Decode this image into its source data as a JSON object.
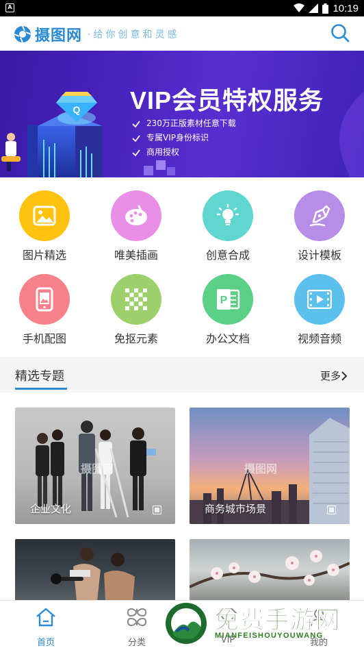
{
  "status_bar": {
    "time": "10:19",
    "notif_letter": "A"
  },
  "header": {
    "logo_text": "摄图网",
    "slogan": "·给你创意和灵感"
  },
  "banner": {
    "title": "VIP会员特权服务",
    "features": [
      "230万正版素材任意下载",
      "专属VIP身份标识",
      "商用授权"
    ],
    "gem_letter": "Q"
  },
  "categories": [
    {
      "label": "图片精选",
      "icon": "image-icon",
      "color": "#ffc20e"
    },
    {
      "label": "唯美插画",
      "icon": "palette-icon",
      "color": "#e98ee6"
    },
    {
      "label": "创意合成",
      "icon": "lightbulb-icon",
      "color": "#5fd6cf"
    },
    {
      "label": "设计模板",
      "icon": "pen-icon",
      "color": "#b88de8"
    },
    {
      "label": "手机配图",
      "icon": "phone-icon",
      "color": "#f6818a"
    },
    {
      "label": "免抠元素",
      "icon": "checker-icon",
      "color": "#9dd06a"
    },
    {
      "label": "办公文档",
      "icon": "ppt-icon",
      "color": "#5ccf86"
    },
    {
      "label": "视频音频",
      "icon": "film-icon",
      "color": "#5cc0ef"
    }
  ],
  "section": {
    "title": "精选专题",
    "more": "更多"
  },
  "topics": [
    {
      "label": "企业文化",
      "watermark": "摄图网"
    },
    {
      "label": "商务城市场景",
      "watermark": "摄图网"
    },
    {
      "label": "",
      "watermark": ""
    },
    {
      "label": "",
      "watermark": ""
    }
  ],
  "bottom_nav": [
    {
      "label": "首页",
      "icon": "home-icon",
      "active": true
    },
    {
      "label": "分类",
      "icon": "category-icon",
      "active": false
    },
    {
      "label": "VIP",
      "icon": "vip-icon",
      "active": false
    },
    {
      "label": "我的",
      "icon": "user-icon",
      "active": false
    }
  ],
  "overlay": {
    "title": "免费手游网",
    "subtitle": "MIANFEISHOUYOUWANG"
  },
  "colors": {
    "brand": "#2a8bd4",
    "banner": "#4a24c0"
  }
}
